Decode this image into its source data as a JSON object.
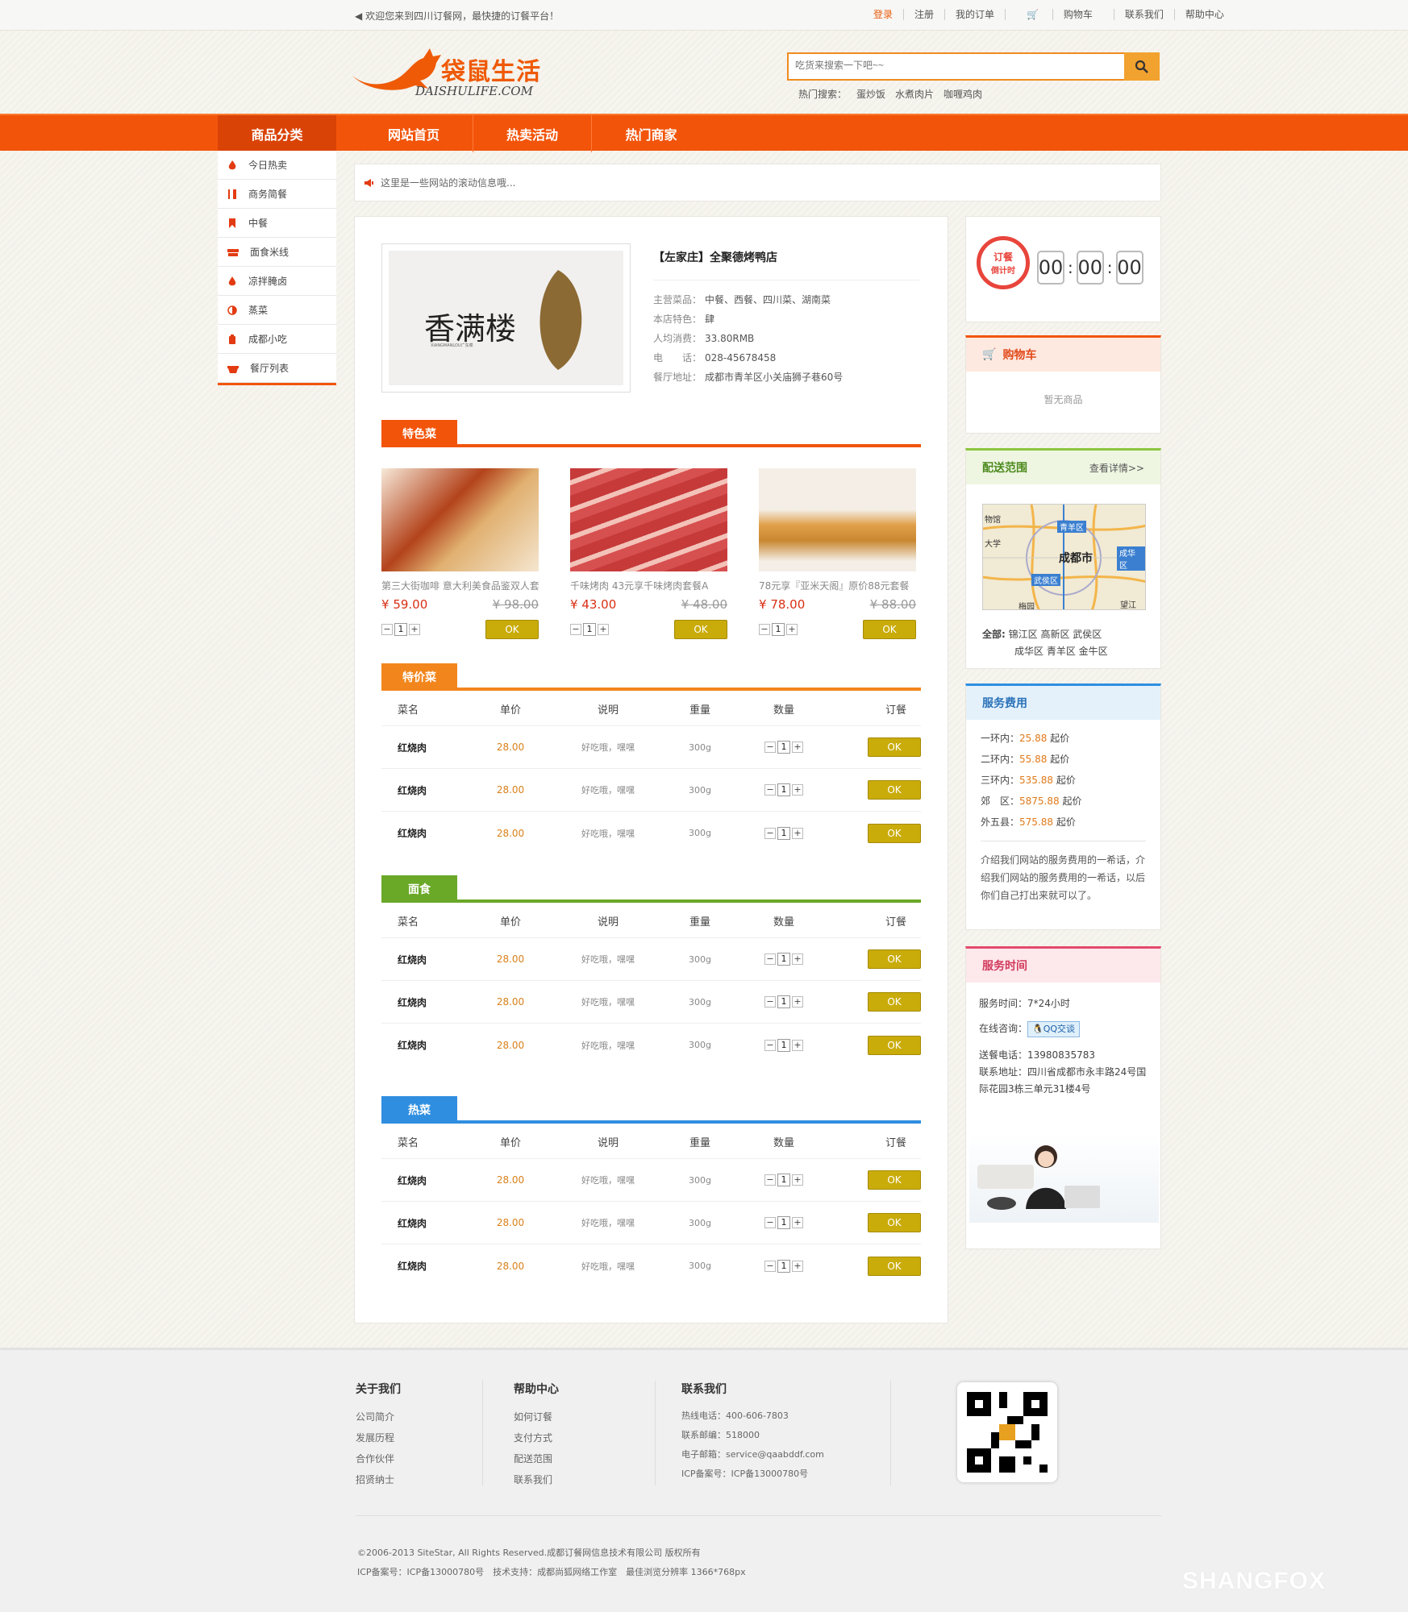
{
  "topbar": {
    "welcome": "欢迎您来到四川订餐网，最快捷的订餐平台！",
    "links": [
      "登录",
      "注册",
      "我的订单",
      "购物车",
      "联系我们",
      "帮助中心"
    ]
  },
  "logo": {
    "cn": "袋鼠生活",
    "en": "DAISHULIFE.COM"
  },
  "search": {
    "placeholder": "吃货来搜索一下吧~~",
    "hot_label": "热门搜索：",
    "hot": [
      "蛋炒饭",
      "水煮肉片",
      "咖喱鸡肉"
    ]
  },
  "nav": {
    "category": "商品分类",
    "items": [
      "网站首页",
      "热卖活动",
      "热门商家"
    ]
  },
  "sidebar": {
    "items": [
      "今日热卖",
      "商务简餐",
      "中餐",
      "面食米线",
      "凉拌腌卤",
      "蒸菜",
      "成都小吃",
      "餐厅列表"
    ]
  },
  "notice": "这里是一些网站的滚动信息哦...",
  "shop": {
    "logo_text": "香满楼",
    "logo_sub": "XIANGMANLOU广东菜",
    "name": "【左家庄】全聚德烤鸭店",
    "info": [
      {
        "k": "主营菜品：",
        "v": "中餐、西餐、四川菜、湖南菜"
      },
      {
        "k": "本店特色：",
        "v": "肆"
      },
      {
        "k": "人均消费：",
        "v": "33.80RMB"
      },
      {
        "k": "电　　话：",
        "v": "028-45678458"
      },
      {
        "k": "餐厅地址：",
        "v": "成都市青羊区小关庙狮子巷60号"
      }
    ]
  },
  "specials": {
    "title": "特色菜",
    "color": "#f2540a",
    "dishes": [
      {
        "name": "第三大街咖啡 意大利美食品鉴双人套",
        "price": "59.00",
        "old": "98.00",
        "qty": "1",
        "ok": "OK"
      },
      {
        "name": "千味烤肉 43元享千味烤肉套餐A",
        "price": "43.00",
        "old": "48.00",
        "qty": "1",
        "ok": "OK"
      },
      {
        "name": "78元享『亚米天阁』原价88元套餐",
        "price": "78.00",
        "old": "88.00",
        "qty": "1",
        "ok": "OK"
      }
    ]
  },
  "headers": [
    "菜名",
    "单价",
    "说明",
    "重量",
    "数量",
    "订餐"
  ],
  "sections": [
    {
      "title": "特价菜",
      "color": "#f2861c",
      "rows": [
        {
          "name": "红烧肉",
          "price": "28.00",
          "desc": "好吃哦，嘿嘿",
          "weight": "300g",
          "qty": "1",
          "ok": "OK"
        },
        {
          "name": "红烧肉",
          "price": "28.00",
          "desc": "好吃哦，嘿嘿",
          "weight": "300g",
          "qty": "1",
          "ok": "OK"
        },
        {
          "name": "红烧肉",
          "price": "28.00",
          "desc": "好吃哦，嘿嘿",
          "weight": "300g",
          "qty": "1",
          "ok": "OK"
        }
      ]
    },
    {
      "title": "面食",
      "color": "#6aa828",
      "rows": [
        {
          "name": "红烧肉",
          "price": "28.00",
          "desc": "好吃哦，嘿嘿",
          "weight": "300g",
          "qty": "1",
          "ok": "OK"
        },
        {
          "name": "红烧肉",
          "price": "28.00",
          "desc": "好吃哦，嘿嘿",
          "weight": "300g",
          "qty": "1",
          "ok": "OK"
        },
        {
          "name": "红烧肉",
          "price": "28.00",
          "desc": "好吃哦，嘿嘿",
          "weight": "300g",
          "qty": "1",
          "ok": "OK"
        }
      ]
    },
    {
      "title": "热菜",
      "color": "#2f8ee0",
      "rows": [
        {
          "name": "红烧肉",
          "price": "28.00",
          "desc": "好吃哦，嘿嘿",
          "weight": "300g",
          "qty": "1",
          "ok": "OK"
        },
        {
          "name": "红烧肉",
          "price": "28.00",
          "desc": "好吃哦，嘿嘿",
          "weight": "300g",
          "qty": "1",
          "ok": "OK"
        },
        {
          "name": "红烧肉",
          "price": "28.00",
          "desc": "好吃哦，嘿嘿",
          "weight": "300g",
          "qty": "1",
          "ok": "OK"
        }
      ]
    }
  ],
  "timer": {
    "label1": "订餐",
    "label2": "倒计时",
    "h": "00",
    "m": "00",
    "s": "00"
  },
  "cart": {
    "title": "购物车",
    "empty": "暂无商品"
  },
  "delivery": {
    "title": "配送范围",
    "more": "查看详情>>",
    "city": "成都市",
    "areas_label": "全部:",
    "areas1": "锦江区 高新区 武侯区",
    "areas2": "成华区 青羊区 金牛区",
    "map_labels": [
      "青羊区",
      "成华区",
      "武侯区",
      "物馆",
      "大学",
      "梅园",
      "望江"
    ]
  },
  "fee": {
    "title": "服务费用",
    "rows": [
      {
        "k": "一环内：",
        "v": "25.88",
        "s": "起价"
      },
      {
        "k": "二环内：",
        "v": "55.88",
        "s": "起价"
      },
      {
        "k": "三环内：",
        "v": "535.88",
        "s": "起价"
      },
      {
        "k": "郊　区：",
        "v": "5875.88",
        "s": "起价"
      },
      {
        "k": "外五县：",
        "v": "575.88",
        "s": "起价"
      }
    ],
    "desc": "介绍我们网站的服务费用的一希话，介绍我们网站的服务费用的一希话，以后你们自己打出来就可以了。"
  },
  "service": {
    "title": "服务时间",
    "time": "服务时间：7*24小时",
    "consult": "在线咨询：",
    "qq": "QQ交谈",
    "phone": "送餐电话：13980835783",
    "addr": "联系地址：四川省成都市永丰路24号国际花园3栋三单元31楼4号"
  },
  "footer": {
    "cols": [
      {
        "title": "关于我们",
        "links": [
          "公司简介",
          "发展历程",
          "合作伙伴",
          "招贤纳士"
        ]
      },
      {
        "title": "帮助中心",
        "links": [
          "如何订餐",
          "支付方式",
          "配送范围",
          "联系我们"
        ]
      },
      {
        "title": "联系我们",
        "links": [
          "热线电话：400-606-7803",
          "联系邮编：518000",
          "电子邮箱：service@qaabddf.com",
          "ICP备案号：ICP备13000780号"
        ]
      }
    ],
    "copy1": "©2006-2013 SiteStar, All Rights Reserved.成都订餐网信息技术有限公司 版权所有",
    "copy2": "ICP备案号：ICP备13000780号　技术支持：成都尚狐网络工作室　最佳浏览分辨率 1366*768px",
    "watermark": "SHANGFOX"
  },
  "colors": {
    "primary": "#f2540a",
    "accent": "#f08b1e",
    "ok": "#c9ac0a"
  }
}
